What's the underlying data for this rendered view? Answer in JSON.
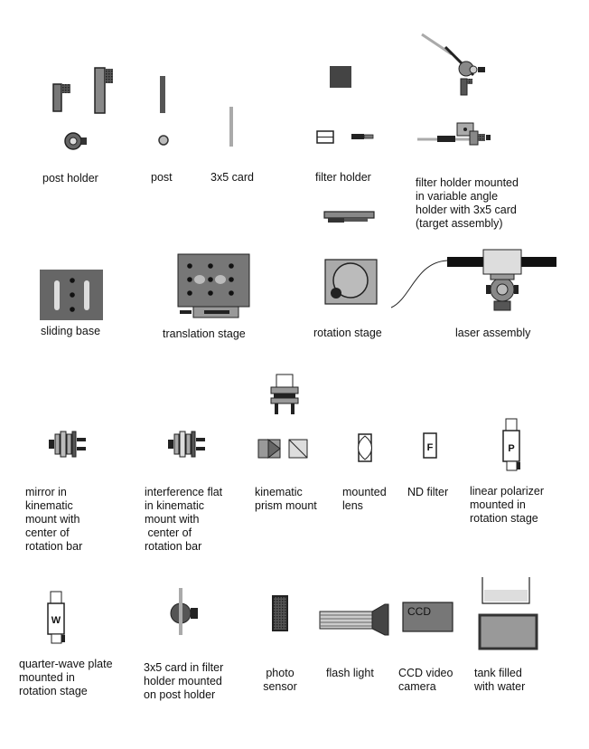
{
  "components": [
    {
      "id": "post-holder",
      "label": "post holder"
    },
    {
      "id": "post",
      "label": "post"
    },
    {
      "id": "card",
      "label": "3x5 card"
    },
    {
      "id": "filter-holder",
      "label": "filter holder"
    },
    {
      "id": "target-assembly",
      "label": "filter holder mounted\nin variable angle\nholder with 3x5 card\n(target assembly)"
    },
    {
      "id": "sliding-base",
      "label": "sliding base"
    },
    {
      "id": "translation-stage",
      "label": "translation stage"
    },
    {
      "id": "rotation-stage",
      "label": "rotation stage"
    },
    {
      "id": "laser-assembly",
      "label": "laser assembly"
    },
    {
      "id": "mirror-mount",
      "label": "mirror in\nkinematic\nmount with\ncenter of\nrotation bar"
    },
    {
      "id": "interference-flat",
      "label": "interference flat\nin kinematic\nmount with\n center of\nrotation bar"
    },
    {
      "id": "prism-mount",
      "label": "kinematic\nprism mount"
    },
    {
      "id": "mounted-lens",
      "label": "mounted\nlens"
    },
    {
      "id": "nd-filter",
      "label": "ND filter"
    },
    {
      "id": "linear-polarizer",
      "label": "linear polarizer\nmounted in\nrotation stage"
    },
    {
      "id": "quarter-wave-plate",
      "label": "quarter-wave plate\nmounted in\nrotation stage"
    },
    {
      "id": "card-in-filter-holder",
      "label": "3x5 card in filter\nholder mounted\non post holder"
    },
    {
      "id": "photo-sensor",
      "label": "photo\nsensor"
    },
    {
      "id": "flash-light",
      "label": "flash light"
    },
    {
      "id": "ccd-camera",
      "label": "CCD video\ncamera"
    },
    {
      "id": "water-tank",
      "label": "tank filled\nwith water"
    }
  ],
  "glyphs": {
    "nd": "F",
    "polarizer": "P",
    "waveplate": "W",
    "ccd": "CCD"
  }
}
